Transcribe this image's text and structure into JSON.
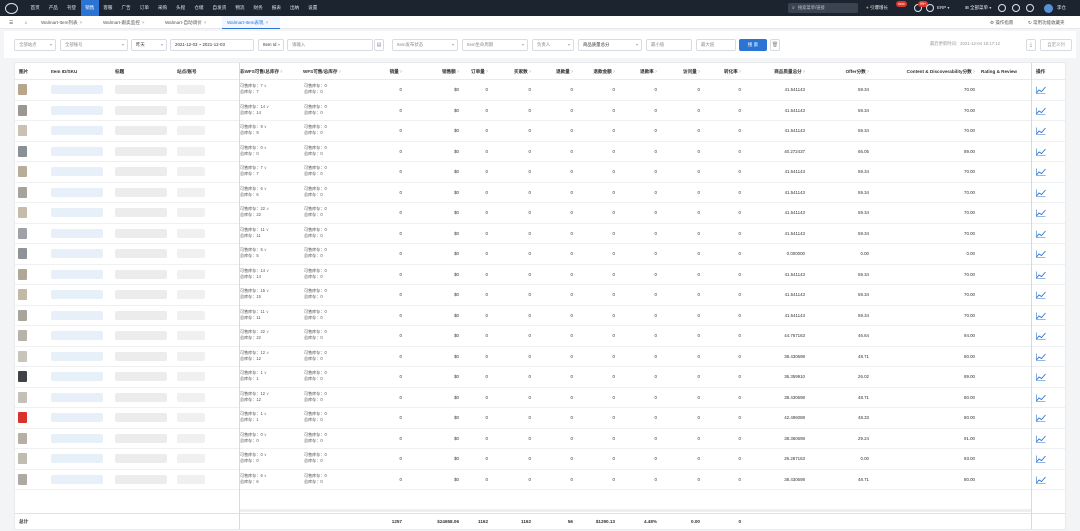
{
  "topnav": {
    "items": [
      "首页",
      "产品",
      "刊登",
      "销售",
      "客服",
      "广告",
      "订单",
      "采购",
      "头程",
      "仓储",
      "自发货",
      "物流",
      "财务",
      "报表",
      "出纳",
      "设置"
    ],
    "active_index": 3,
    "search_placeholder": "搜索菜单/链接",
    "brand_label": "引爆增长",
    "new_badge": "new",
    "msg_badge": "99+",
    "erp_label": "ERP",
    "all_menu_label": "全部菜单",
    "user_name": "李仓"
  },
  "tabs": {
    "items": [
      {
        "label": "Walmart-Item列表"
      },
      {
        "label": "Walmart-跟卖监控"
      },
      {
        "label": "Walmart-自动调价"
      },
      {
        "label": "Walmart-Item表现"
      }
    ],
    "active_index": 3,
    "close_glyph": "×",
    "guide_label": "操作指南",
    "feature_label": "常用功能收藏夹"
  },
  "filters": {
    "site": "全部站点",
    "account": "全部账号",
    "period": "昨天",
    "date_range": "2021-12-03 ~ 2021-12-03",
    "id_type": "Item Id",
    "id_placeholder": "请输入",
    "wfs_status": "Item发布状态",
    "lifecycle": "Item生命周期",
    "owner": "负责人",
    "metric": "商品质量总分",
    "min_placeholder": "最小值",
    "max_placeholder": "最大值",
    "search_label": "搜 索",
    "updated_text": "最后更新时间：2021-12-04 19:17:12",
    "export_label": "自定义列"
  },
  "table": {
    "headers": {
      "image": "图片",
      "item_sku": "Item ID/SKU",
      "title": "标题",
      "site_account": "站点/账号",
      "non_wfs": "非WFS可售/总库存",
      "wfs": "WFS可售/总库存",
      "sales_qty": "销量",
      "sales_amount": "销售额",
      "orders": "订单量",
      "buyers": "买家数",
      "refunds": "退款量",
      "refund_amount": "退款金额",
      "refund_rate": "退款率",
      "visits": "访问量",
      "conversion": "转化率",
      "quality_score": "商品质量总分",
      "offer_score": "Offer分数",
      "content_score": "Content & Discoverability分数",
      "rating_review": "Rating & Review",
      "actions": "操作"
    },
    "labels": {
      "available": "可售库存：",
      "total": "总库存：",
      "help_glyph": "?"
    },
    "rows": [
      {
        "avail": "7",
        "total": "7",
        "wfs_avail": "0",
        "wfs_total": "0",
        "sales": "0",
        "amount": "$0",
        "orders": "0",
        "buyers": "0",
        "refunds": "0",
        "refund_amt": "0",
        "refund_rate": "0",
        "visits": "0",
        "conv": "0",
        "quality": "41.541143",
        "offer": "59.34",
        "content": "70.00",
        "thumb": "#b9a58c"
      },
      {
        "avail": "14",
        "total": "14",
        "wfs_avail": "0",
        "wfs_total": "0",
        "sales": "0",
        "amount": "$0",
        "orders": "0",
        "buyers": "0",
        "refunds": "0",
        "refund_amt": "0",
        "refund_rate": "0",
        "visits": "0",
        "conv": "0",
        "quality": "41.541143",
        "offer": "59.34",
        "content": "70.00",
        "thumb": "#9a9890"
      },
      {
        "avail": "9",
        "total": "9",
        "wfs_avail": "0",
        "wfs_total": "0",
        "sales": "0",
        "amount": "$0",
        "orders": "0",
        "buyers": "0",
        "refunds": "0",
        "refund_amt": "0",
        "refund_rate": "0",
        "visits": "0",
        "conv": "0",
        "quality": "41.541143",
        "offer": "59.34",
        "content": "70.00",
        "thumb": "#c9c2b2"
      },
      {
        "avail": "0",
        "total": "0",
        "wfs_avail": "0",
        "wfs_total": "0",
        "sales": "0",
        "amount": "$0",
        "orders": "0",
        "buyers": "0",
        "refunds": "0",
        "refund_amt": "0",
        "refund_rate": "0",
        "visits": "0",
        "conv": "0",
        "quality": "40.272437",
        "offer": "66.05",
        "content": "89.00",
        "thumb": "#8b8f96"
      },
      {
        "avail": "7",
        "total": "7",
        "wfs_avail": "0",
        "wfs_total": "0",
        "sales": "0",
        "amount": "$0",
        "orders": "0",
        "buyers": "0",
        "refunds": "0",
        "refund_amt": "0",
        "refund_rate": "0",
        "visits": "0",
        "conv": "0",
        "quality": "41.541143",
        "offer": "59.34",
        "content": "70.00",
        "thumb": "#b8ad98"
      },
      {
        "avail": "6",
        "total": "6",
        "wfs_avail": "0",
        "wfs_total": "0",
        "sales": "0",
        "amount": "$0",
        "orders": "0",
        "buyers": "0",
        "refunds": "0",
        "refund_amt": "0",
        "refund_rate": "0",
        "visits": "0",
        "conv": "0",
        "quality": "41.541143",
        "offer": "59.34",
        "content": "70.00",
        "thumb": "#a6a39c"
      },
      {
        "avail": "22",
        "total": "22",
        "wfs_avail": "0",
        "wfs_total": "0",
        "sales": "0",
        "amount": "$0",
        "orders": "0",
        "buyers": "0",
        "refunds": "0",
        "refund_amt": "0",
        "refund_rate": "0",
        "visits": "0",
        "conv": "0",
        "quality": "41.541143",
        "offer": "59.34",
        "content": "70.00",
        "thumb": "#c5bda9"
      },
      {
        "avail": "11",
        "total": "11",
        "wfs_avail": "0",
        "wfs_total": "0",
        "sales": "0",
        "amount": "$0",
        "orders": "0",
        "buyers": "0",
        "refunds": "0",
        "refund_amt": "0",
        "refund_rate": "0",
        "visits": "0",
        "conv": "0",
        "quality": "41.541143",
        "offer": "59.34",
        "content": "70.00",
        "thumb": "#9ea2a6"
      },
      {
        "avail": "5",
        "total": "5",
        "wfs_avail": "0",
        "wfs_total": "0",
        "sales": "0",
        "amount": "$0",
        "orders": "0",
        "buyers": "0",
        "refunds": "0",
        "refund_amt": "0",
        "refund_rate": "0",
        "visits": "0",
        "conv": "0",
        "quality": "0.000000",
        "offer": "0.00",
        "content": "0.00",
        "thumb": "#8d9399"
      },
      {
        "avail": "14",
        "total": "14",
        "wfs_avail": "0",
        "wfs_total": "0",
        "sales": "0",
        "amount": "$0",
        "orders": "0",
        "buyers": "0",
        "refunds": "0",
        "refund_amt": "0",
        "refund_rate": "0",
        "visits": "0",
        "conv": "0",
        "quality": "41.541143",
        "offer": "59.34",
        "content": "70.00",
        "thumb": "#b0a896"
      },
      {
        "avail": "15",
        "total": "15",
        "wfs_avail": "0",
        "wfs_total": "0",
        "sales": "0",
        "amount": "$0",
        "orders": "0",
        "buyers": "0",
        "refunds": "0",
        "refund_amt": "0",
        "refund_rate": "0",
        "visits": "0",
        "conv": "0",
        "quality": "41.541143",
        "offer": "59.34",
        "content": "70.00",
        "thumb": "#c2baa6"
      },
      {
        "avail": "11",
        "total": "11",
        "wfs_avail": "0",
        "wfs_total": "0",
        "sales": "0",
        "amount": "$0",
        "orders": "0",
        "buyers": "0",
        "refunds": "0",
        "refund_amt": "0",
        "refund_rate": "0",
        "visits": "0",
        "conv": "0",
        "quality": "41.541143",
        "offer": "59.34",
        "content": "70.00",
        "thumb": "#a9a59d"
      },
      {
        "avail": "22",
        "total": "22",
        "wfs_avail": "0",
        "wfs_total": "0",
        "sales": "0",
        "amount": "$0",
        "orders": "0",
        "buyers": "0",
        "refunds": "0",
        "refund_amt": "0",
        "refund_rate": "0",
        "visits": "0",
        "conv": "0",
        "quality": "44.767163",
        "offer": "46.64",
        "content": "94.00",
        "thumb": "#b7b3aa"
      },
      {
        "avail": "12",
        "total": "12",
        "wfs_avail": "0",
        "wfs_total": "0",
        "sales": "0",
        "amount": "$0",
        "orders": "0",
        "buyers": "0",
        "refunds": "0",
        "refund_amt": "0",
        "refund_rate": "0",
        "visits": "0",
        "conv": "0",
        "quality": "38.430698",
        "offer": "48.71",
        "content": "80.00",
        "thumb": "#c8c4bb"
      },
      {
        "avail": "1",
        "total": "1",
        "wfs_avail": "0",
        "wfs_total": "0",
        "sales": "0",
        "amount": "$0",
        "orders": "0",
        "buyers": "0",
        "refunds": "0",
        "refund_amt": "0",
        "refund_rate": "0",
        "visits": "0",
        "conv": "0",
        "quality": "36.359910",
        "offer": "26.02",
        "content": "89.00",
        "thumb": "#3f4246"
      },
      {
        "avail": "12",
        "total": "12",
        "wfs_avail": "0",
        "wfs_total": "0",
        "sales": "0",
        "amount": "$0",
        "orders": "0",
        "buyers": "0",
        "refunds": "0",
        "refund_amt": "0",
        "refund_rate": "0",
        "visits": "0",
        "conv": "0",
        "quality": "38.430698",
        "offer": "48.71",
        "content": "80.00",
        "thumb": "#c4c0b6"
      },
      {
        "avail": "1",
        "total": "1",
        "wfs_avail": "0",
        "wfs_total": "0",
        "sales": "0",
        "amount": "$0",
        "orders": "0",
        "buyers": "0",
        "refunds": "0",
        "refund_amt": "0",
        "refund_rate": "0",
        "visits": "0",
        "conv": "0",
        "quality": "42.496088",
        "offer": "48.33",
        "content": "80.00",
        "thumb": "#d9322b"
      },
      {
        "avail": "0",
        "total": "0",
        "wfs_avail": "0",
        "wfs_total": "0",
        "sales": "0",
        "amount": "$0",
        "orders": "0",
        "buyers": "0",
        "refunds": "0",
        "refund_amt": "0",
        "refund_rate": "0",
        "visits": "0",
        "conv": "0",
        "quality": "38.360698",
        "offer": "29.24",
        "content": "91.00",
        "thumb": "#b6b0a4"
      },
      {
        "avail": "0",
        "total": "0",
        "wfs_avail": "0",
        "wfs_total": "0",
        "sales": "0",
        "amount": "$0",
        "orders": "0",
        "buyers": "0",
        "refunds": "0",
        "refund_amt": "0",
        "refund_rate": "0",
        "visits": "0",
        "conv": "0",
        "quality": "26.287163",
        "offer": "0.00",
        "content": "93.00",
        "thumb": "#c1bcb1"
      },
      {
        "avail": "6",
        "total": "6",
        "wfs_avail": "0",
        "wfs_total": "0",
        "sales": "0",
        "amount": "$0",
        "orders": "0",
        "buyers": "0",
        "refunds": "0",
        "refund_amt": "0",
        "refund_rate": "0",
        "visits": "0",
        "conv": "0",
        "quality": "38.430698",
        "offer": "48.71",
        "content": "80.00",
        "thumb": "#aeaaa1"
      }
    ],
    "footer": {
      "label": "总计",
      "sales": "1257",
      "amount": "$24658.06",
      "orders": "1162",
      "buyers": "1162",
      "refunds": "56",
      "refund_amt": "$1290.13",
      "refund_rate": "4.48%",
      "visits": "0.00",
      "conv": "0"
    }
  },
  "colors": {
    "accent": "#2b74d4",
    "nav_bg": "#1c2430",
    "trend_icon": "#2b74d4"
  }
}
